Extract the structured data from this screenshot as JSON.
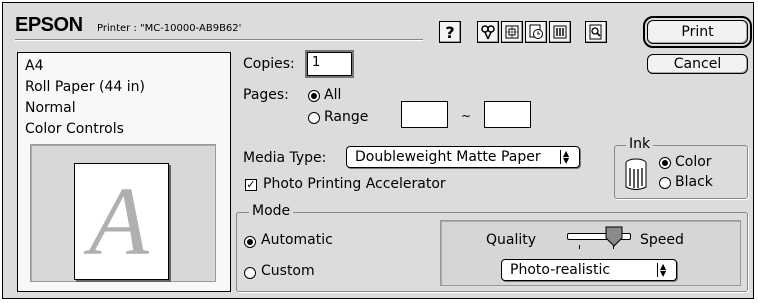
{
  "header": {
    "brand": "EPSON",
    "printer_label": "Printer : \"MC-10000-AB9B62'"
  },
  "toolbar": {
    "help": "?",
    "icons": [
      "tools-icon",
      "layout-icon",
      "background-printing-icon",
      "custom-settings-icon",
      "preview-icon"
    ]
  },
  "buttons": {
    "print": "Print",
    "cancel": "Cancel"
  },
  "summary": {
    "items": [
      "A4",
      "Roll Paper (44 in)",
      "Normal",
      "Color Controls"
    ],
    "preview_letter": "A"
  },
  "copies": {
    "label": "Copies:",
    "value": "1"
  },
  "pages": {
    "label": "Pages:",
    "all_label": "All",
    "range_label": "Range",
    "range_sep": "~",
    "range_from": "",
    "range_to": ""
  },
  "media": {
    "label": "Media Type:",
    "value": "Doubleweight Matte Paper"
  },
  "accelerator": {
    "label": "Photo Printing Accelerator",
    "checked": true
  },
  "ink": {
    "label": "Ink",
    "color_label": "Color",
    "black_label": "Black",
    "selected": "Color"
  },
  "mode": {
    "label": "Mode",
    "automatic_label": "Automatic",
    "custom_label": "Custom",
    "selected": "Automatic",
    "quality_label": "Quality",
    "speed_label": "Speed",
    "quality_preset": "Photo-realistic"
  }
}
